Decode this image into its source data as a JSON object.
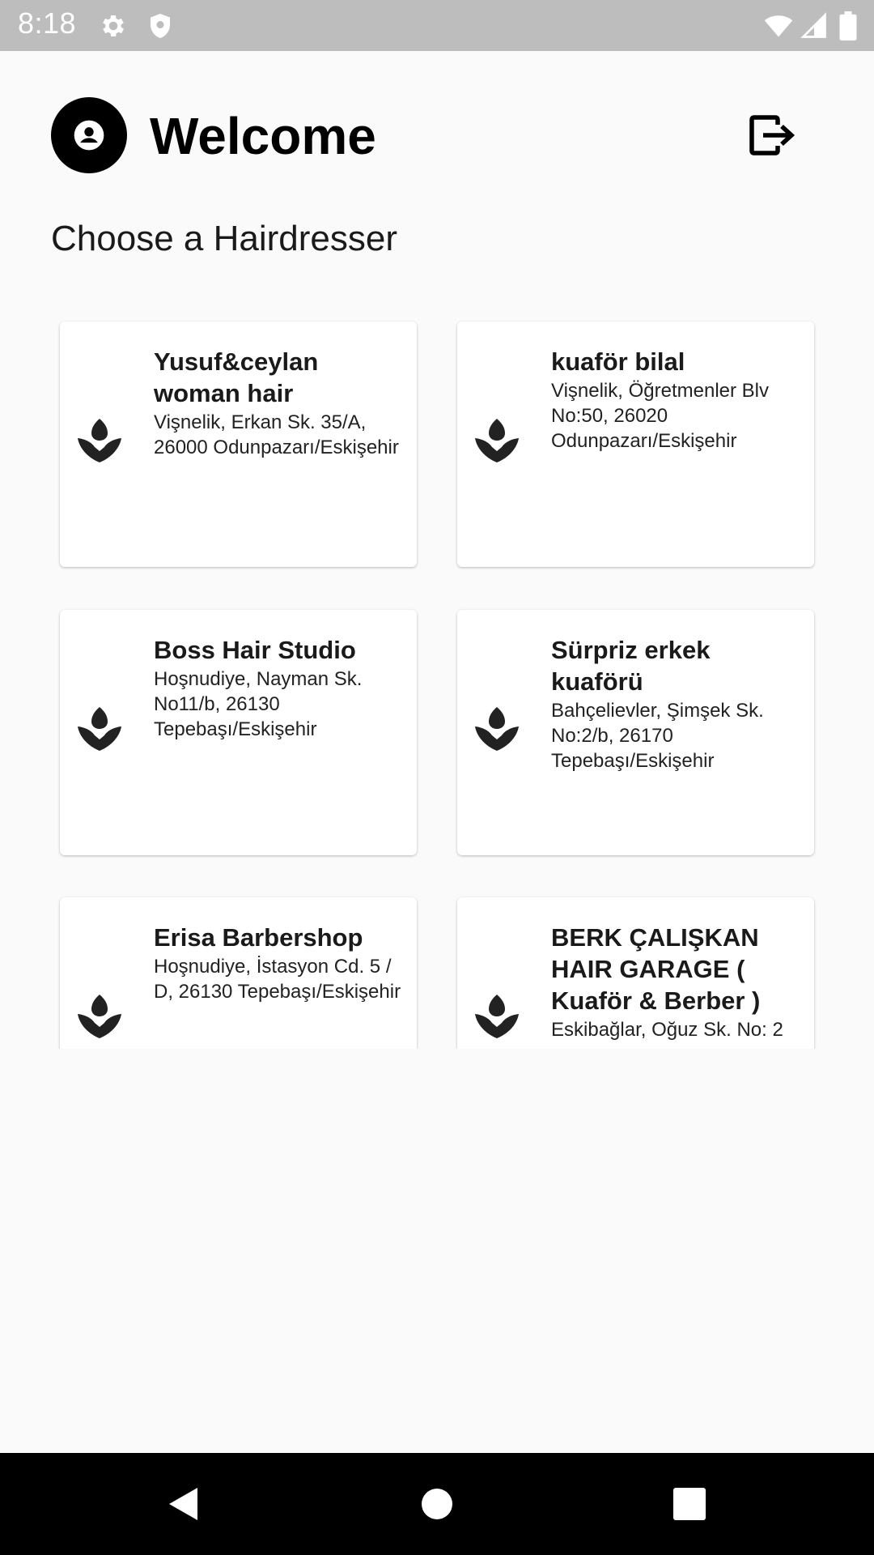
{
  "status_bar": {
    "time": "8:18",
    "icons": [
      "gear-icon",
      "shield-icon",
      "wifi-icon",
      "signal-icon",
      "battery-icon"
    ]
  },
  "header": {
    "title": "Welcome",
    "subtitle": "Choose a Hairdresser",
    "avatar_icon": "account-circle-icon",
    "logout_icon": "logout-icon"
  },
  "hairdressers": [
    {
      "name": "Yusuf&ceylan woman hair",
      "address": "Vişnelik, Erkan Sk. 35/A, 26000 Odunpazarı/Eskişehir",
      "icon": "spa-icon"
    },
    {
      "name": "kuaför bilal",
      "address": "Vişnelik, Öğretmenler Blv No:50, 26020 Odunpazarı/Eskişehir",
      "icon": "spa-icon"
    },
    {
      "name": "Boss Hair Studio",
      "address": "Hoşnudiye, Nayman Sk. No11/b, 26130 Tepebaşı/Eskişehir",
      "icon": "spa-icon"
    },
    {
      "name": "Sürpriz erkek kuaförü",
      "address": "Bahçelievler, Şimşek Sk. No:2/b, 26170 Tepebaşı/Eskişehir",
      "icon": "spa-icon"
    },
    {
      "name": "Erisa Barbershop",
      "address": "Hoşnudiye, İstasyon Cd. 5 / D, 26130 Tepebaşı/Eskişehir",
      "icon": "spa-icon"
    },
    {
      "name": "BERK ÇALIŞKAN HAIR GARAGE ( Kuaför & Berber )",
      "address": "Eskibağlar, Oğuz Sk. No: 2",
      "icon": "spa-icon"
    }
  ],
  "nav_bar": {
    "back_icon": "back-triangle-icon",
    "home_icon": "home-circle-icon",
    "recents_icon": "recents-square-icon"
  },
  "colors": {
    "background": "#fafafa",
    "status_bar": "#bdbdbd",
    "nav_bar": "#000000",
    "card": "#ffffff",
    "text": "#1a1a1a"
  }
}
